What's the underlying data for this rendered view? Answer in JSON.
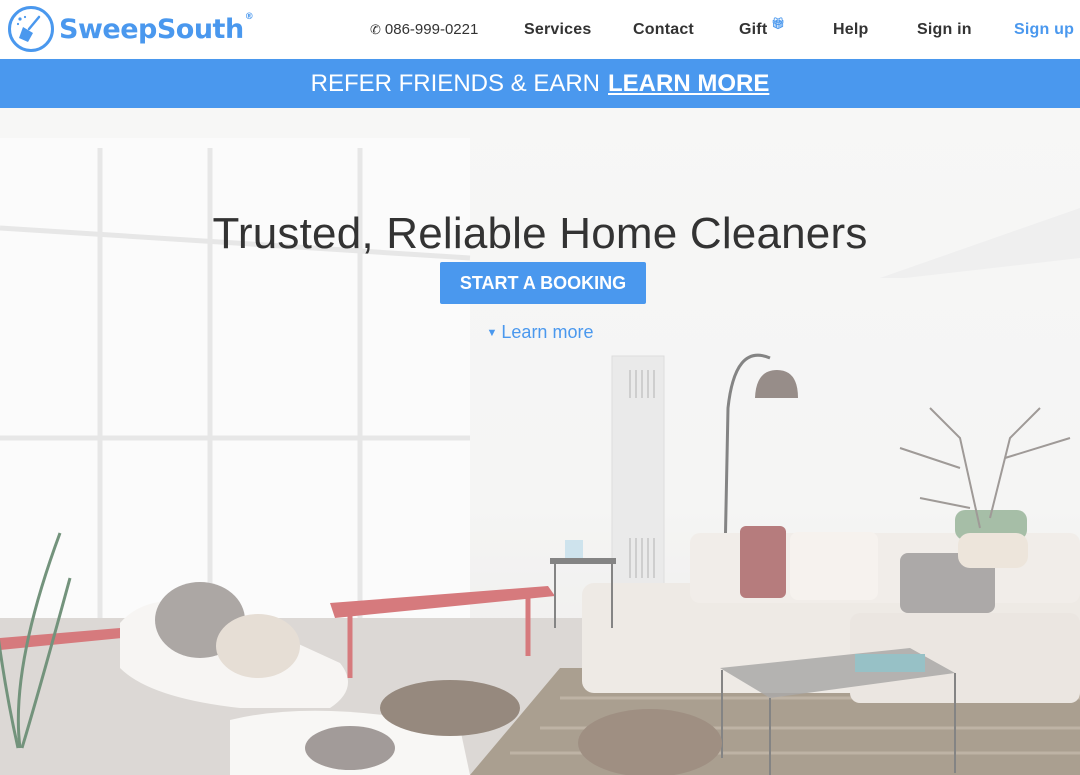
{
  "brand": {
    "name": "SweepSouth",
    "registered_mark": "®",
    "color": "#4a98ee"
  },
  "nav": {
    "phone": "086-999-0221",
    "phone_icon": "phone-icon",
    "services": "Services",
    "contact": "Contact",
    "gift": "Gift",
    "gift_icon": "gift-icon",
    "help": "Help",
    "sign_in": "Sign in",
    "sign_up": "Sign up"
  },
  "banner": {
    "text": "REFER FRIENDS & EARN",
    "link": "LEARN MORE"
  },
  "hero": {
    "headline": "Trusted, Reliable Home Cleaners",
    "cta": "START A BOOKING",
    "learn_more": "Learn more",
    "learn_more_icon": "caret-down-icon",
    "background": "living-room-photo"
  }
}
